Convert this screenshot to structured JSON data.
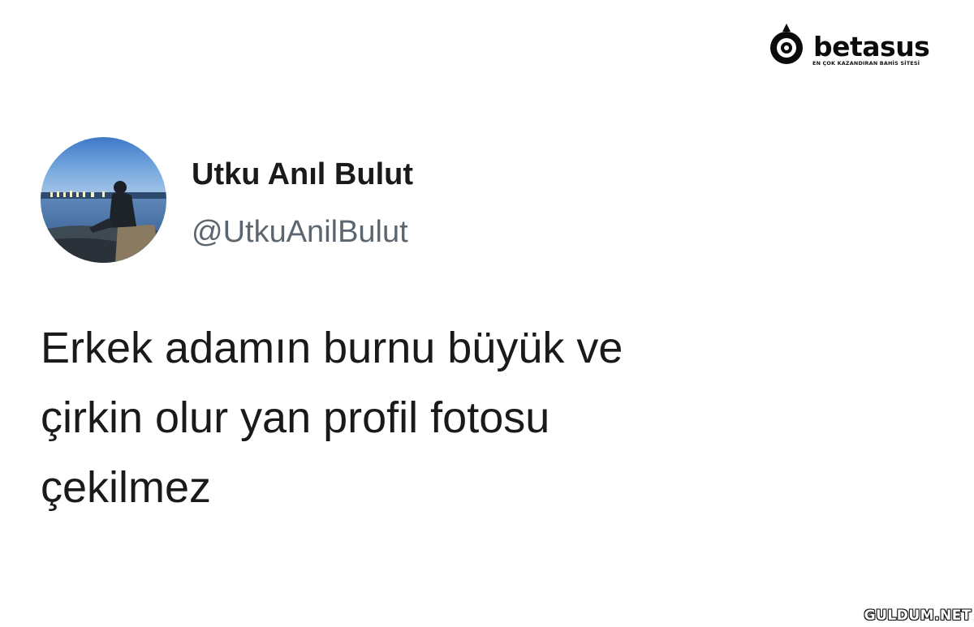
{
  "brand": {
    "name": "betasus",
    "tagline": "EN ÇOK KAZANDIRAN BAHİS SİTESİ"
  },
  "tweet": {
    "display_name": "Utku Anıl Bulut",
    "handle": "@UtkuAnilBulut",
    "text_lines": [
      "Erkek adamın burnu büyük ve",
      "çirkin olur yan profil fotosu",
      "çekilmez"
    ]
  },
  "watermark": "GULDUM.NET",
  "colors": {
    "text": "#1a1a1a",
    "handle": "#5b6670",
    "background": "#ffffff"
  }
}
